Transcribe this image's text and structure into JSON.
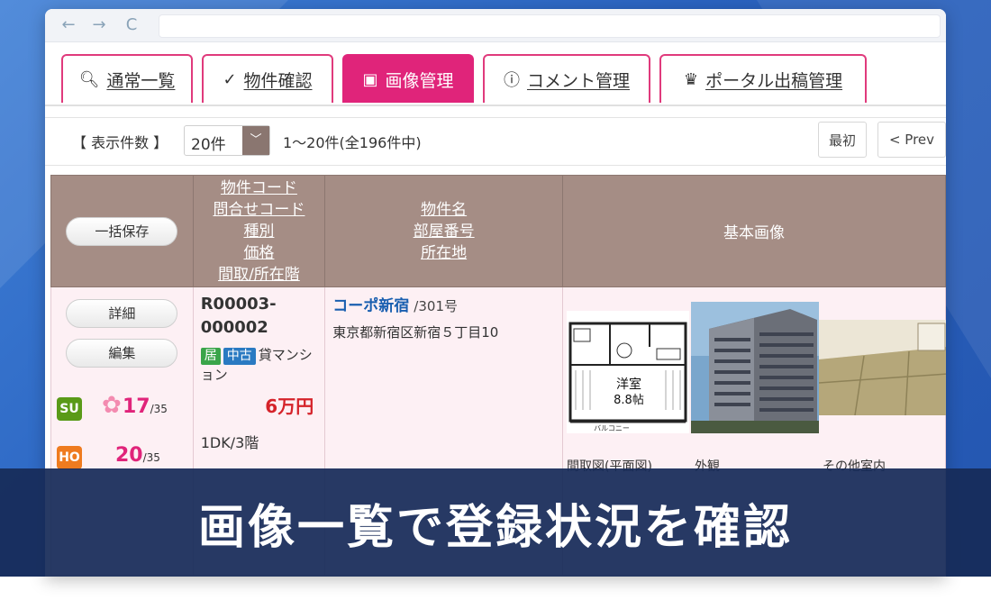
{
  "banner": {
    "text": "画像一覧で登録状況を確認"
  },
  "browser": {
    "back_icon": "←",
    "forward_icon": "→",
    "reload_icon": "C"
  },
  "tabs": [
    {
      "label": "通常一覧",
      "icon": "search-icon",
      "glyph": "🔍︎",
      "active": false
    },
    {
      "label": "物件確認",
      "icon": "check-circle-icon",
      "glyph": "✓",
      "active": false
    },
    {
      "label": "画像管理",
      "icon": "image-icon",
      "glyph": "▣",
      "active": true
    },
    {
      "label": "コメント管理",
      "icon": "alert-circle-icon",
      "glyph": "ⓘ",
      "active": false
    },
    {
      "label": "ポータル出稿管理",
      "icon": "crown-icon",
      "glyph": "♛",
      "active": false
    }
  ],
  "toolbar": {
    "count_label": "【 表示件数 】",
    "select_value": "20件",
    "select_arrow": "﹀",
    "range_text": "1～20件(全196件中)",
    "first_label": "最初",
    "prev_label": "< Prev"
  },
  "table": {
    "headers": {
      "bulk_save": "一括保存",
      "col2": [
        "物件コード",
        "問合せコード",
        "種別",
        "価格",
        "間取/所在階"
      ],
      "col3": [
        "物件名",
        "部屋番号",
        "所在地"
      ],
      "col4": "基本画像"
    },
    "row": {
      "detail_label": "詳細",
      "edit_label": "編集",
      "code": "R00003-000002",
      "tag1": "居",
      "tag2": "中古",
      "type": "貸マンション",
      "price": "6万円",
      "madori": "1DK/3階",
      "name": "コーポ新宿",
      "room": "/301号",
      "address": "東京都新宿区新宿５丁目10",
      "scores": [
        {
          "badge": "SU",
          "value": "17",
          "max": "/35"
        },
        {
          "badge": "HO",
          "value": "20",
          "max": "/35"
        }
      ],
      "images": [
        {
          "caption": "間取図(平面図)",
          "floor_label": "洋室",
          "floor_size": "8.8帖",
          "balcony": "バルコニー"
        },
        {
          "caption": "外観"
        },
        {
          "caption": "その他室内"
        }
      ]
    }
  },
  "colors": {
    "accent": "#e0247a",
    "header_bg": "#a58d85",
    "price": "#d5232a",
    "link": "#1a5fb0"
  }
}
